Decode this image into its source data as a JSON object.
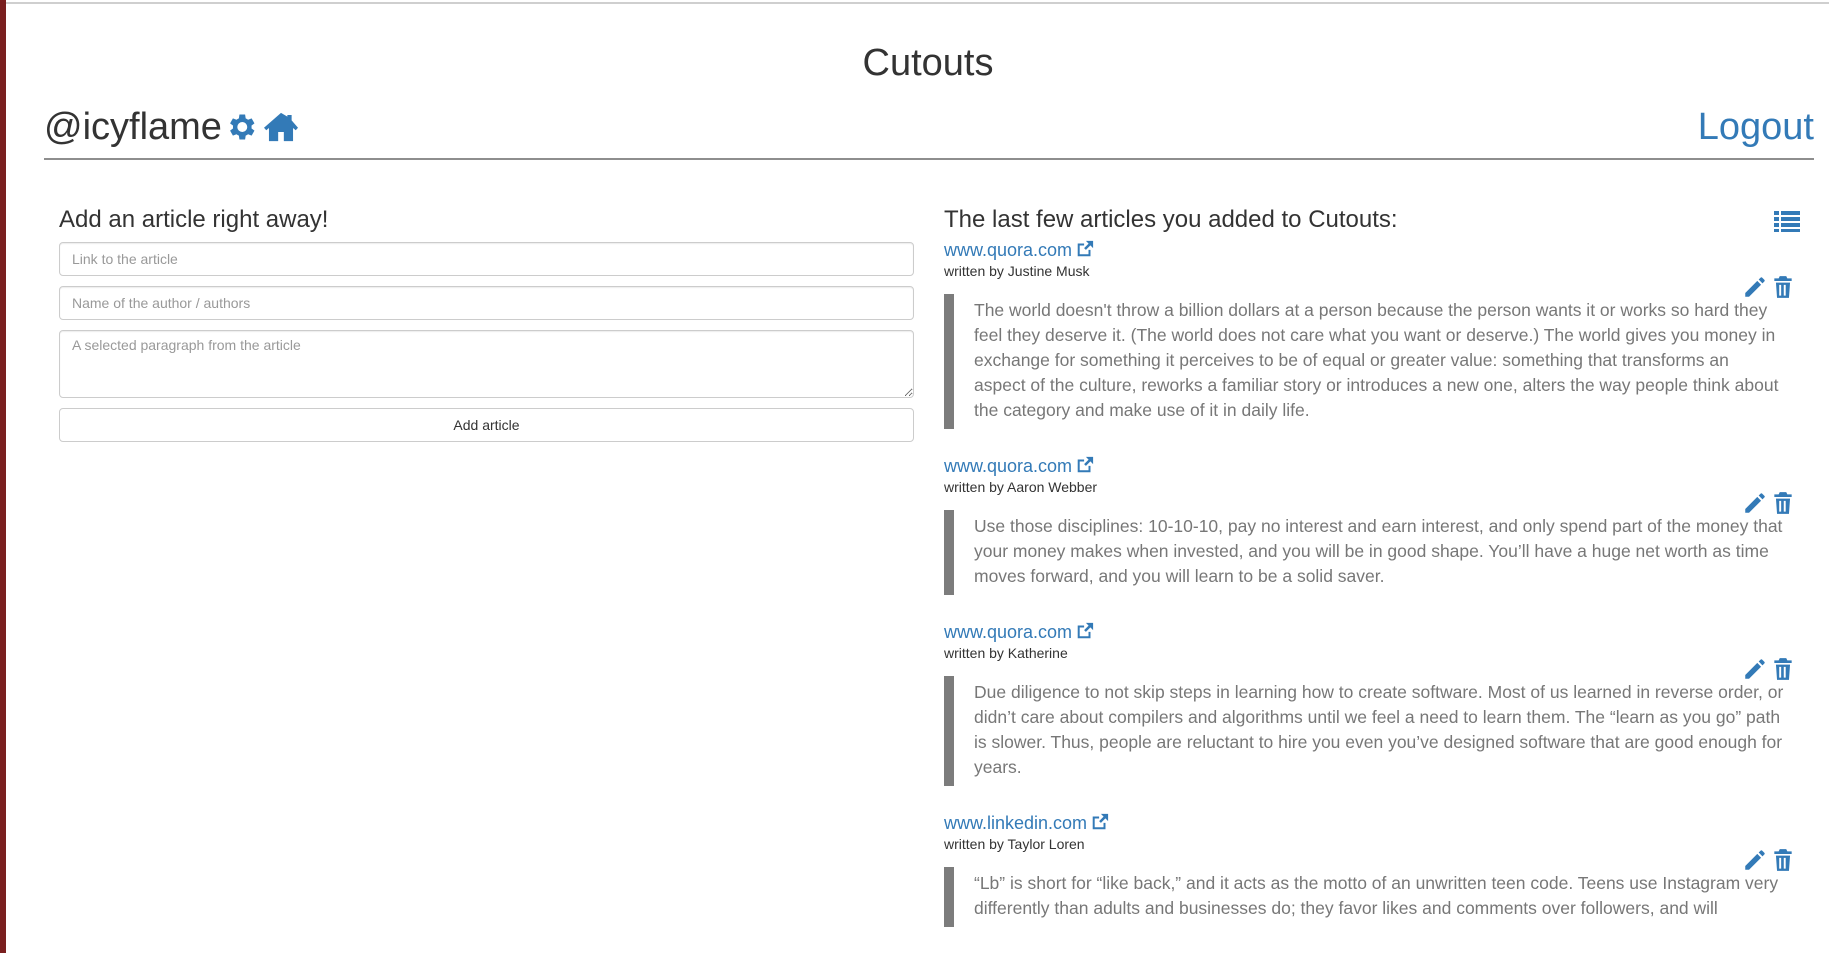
{
  "header": {
    "site_title": "Cutouts",
    "username": "@icyflame",
    "settings_icon": "gear-icon",
    "home_icon": "home-icon",
    "logout_label": "Logout"
  },
  "form": {
    "title": "Add an article right away!",
    "link_placeholder": "Link to the article",
    "author_placeholder": "Name of the author / authors",
    "paragraph_placeholder": "A selected paragraph from the article",
    "submit_label": "Add article"
  },
  "articles_panel": {
    "title": "The last few articles you added to Cutouts:",
    "list_icon": "list-icon",
    "items": [
      {
        "domain": "www.quora.com",
        "author": "written by Justine Musk",
        "quote": "The world doesn't throw a billion dollars at a person because the person wants it or works so hard they feel they deserve it. (The world does not care what you want or deserve.) The world gives you money in exchange for something it perceives to be of equal or greater value: something that transforms an aspect of the culture, reworks a familiar story or introduces a new one, alters the way people think about the category and make use of it in daily life."
      },
      {
        "domain": "www.quora.com",
        "author": "written by Aaron Webber",
        "quote": "Use those disciplines: 10-10-10, pay no interest and earn interest, and only spend part of the money that your money makes when invested, and you will be in good shape. You’ll have a huge net worth as time moves forward, and you will learn to be a solid saver."
      },
      {
        "domain": "www.quora.com",
        "author": "written by Katherine",
        "quote": "Due diligence to not skip steps in learning how to create software. Most of us learned in reverse order, or didn’t care about compilers and algorithms until we feel a need to learn them. The “learn as you go” path is slower. Thus, people are reluctant to hire you even you’ve designed software that are good enough for years."
      },
      {
        "domain": "www.linkedin.com",
        "author": "written by Taylor Loren",
        "quote": "“Lb” is short for “like back,” and it acts as the motto of an unwritten teen code. Teens use Instagram very differently than adults and businesses do; they favor likes and comments over followers, and will"
      }
    ]
  },
  "colors": {
    "link_blue": "#337ab7",
    "text_dark": "#333333",
    "quote_gray": "#777777",
    "quote_border": "#7c7c7c"
  }
}
